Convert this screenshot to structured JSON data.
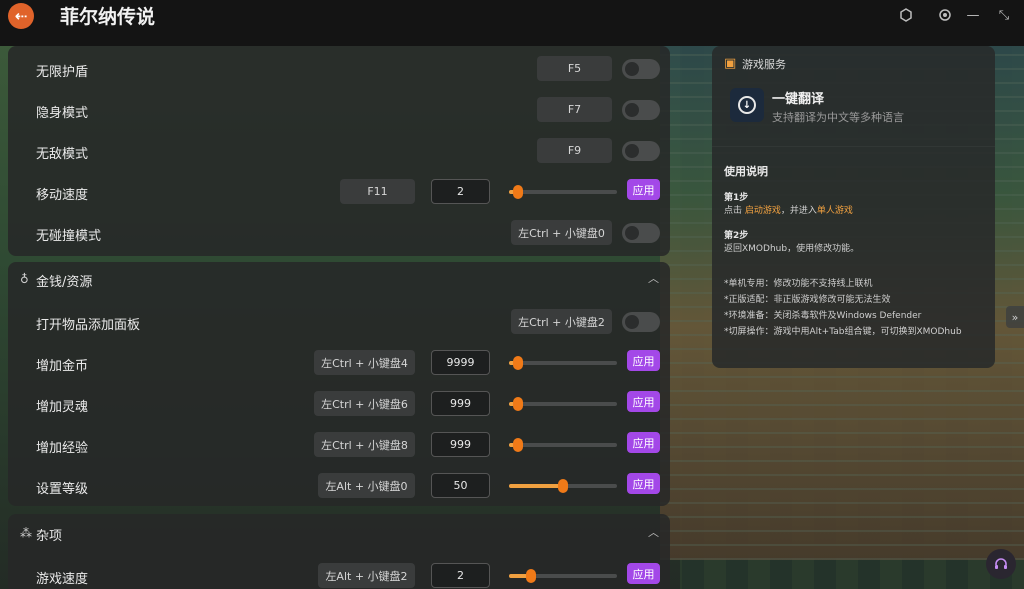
{
  "app": {
    "title": "菲尔纳传说",
    "back_icon": "arrow-left-icon",
    "accent": "#a348e8"
  },
  "window_controls": [
    {
      "icon": "user-badge-icon"
    },
    {
      "icon": "settings-gear-icon"
    },
    {
      "icon": "minimize-icon"
    },
    {
      "icon": "collapse-icon"
    }
  ],
  "section_top": {
    "rows": [
      {
        "label": "无限护盾",
        "key": "F5"
      },
      {
        "label": "隐身模式",
        "key": "F7"
      },
      {
        "label": "无敌模式",
        "key": "F9"
      },
      {
        "label": "移动速度",
        "key": "F11",
        "value": "2",
        "apply": "应用",
        "slider_fraction": 0.08
      },
      {
        "label": "无碰撞模式",
        "key": "左Ctrl + 小键盘0"
      }
    ]
  },
  "section_money": {
    "title": "金钱/资源",
    "rows": [
      {
        "label": "打开物品添加面板",
        "key": "左Ctrl + 小键盘2"
      },
      {
        "label": "增加金币",
        "key": "左Ctrl + 小键盘4",
        "value": "9999",
        "apply": "应用",
        "slider_fraction": 0.08
      },
      {
        "label": "增加灵魂",
        "key": "左Ctrl + 小键盘6",
        "value": "999",
        "apply": "应用",
        "slider_fraction": 0.08
      },
      {
        "label": "增加经验",
        "key": "左Ctrl + 小键盘8",
        "value": "999",
        "apply": "应用",
        "slider_fraction": 0.08
      },
      {
        "label": "设置等级",
        "key": "左Alt + 小键盘0",
        "value": "50",
        "apply": "应用",
        "slider_fraction": 0.5
      }
    ]
  },
  "section_misc": {
    "title": "杂项",
    "rows": [
      {
        "label": "游戏速度",
        "key": "左Alt + 小键盘2",
        "value": "2",
        "apply": "应用",
        "slider_fraction": 0.2
      }
    ]
  },
  "service": {
    "title": "游戏服务",
    "translate_title": "一键翻译",
    "translate_sub": "支持翻译为中文等多种语言"
  },
  "guide": {
    "title": "使用说明",
    "step1_h": "第1步",
    "step1_a": "点击 ",
    "step1_b": "启动游戏",
    "step1_c": "，并进入",
    "step1_d": "单人游戏",
    "step2_h": "第2步",
    "step2_t": "返回XMODhub，使用修改功能。",
    "notes": [
      "*单机专用：修改功能不支持线上联机",
      "*正版适配：非正版游戏修改可能无法生效",
      "*环境准备：关闭杀毒软件及Windows Defender",
      "*切屏操作：游戏中用Alt+Tab组合键，可切换到XMODhub"
    ]
  }
}
